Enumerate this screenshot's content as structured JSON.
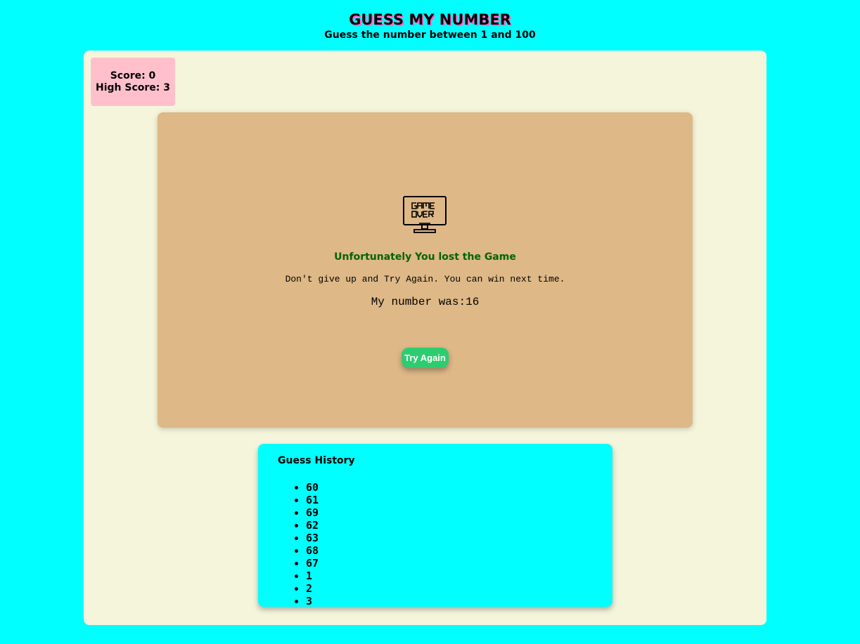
{
  "header": {
    "title": "GUESS MY NUMBER",
    "subtitle": "Guess the number between 1 and 100"
  },
  "score": {
    "score_text": "Score: 0",
    "high_score_text": "High Score: 3"
  },
  "result": {
    "icon": "game-over-monitor-icon",
    "message": "Unfortunately You lost the Game",
    "encouragement": "Don't give up and Try Again. You can win next time.",
    "number_reveal": "My number was:16",
    "try_again_label": "Try Again"
  },
  "history": {
    "title": "Guess History",
    "guesses": [
      "60",
      "61",
      "69",
      "62",
      "63",
      "68",
      "67",
      "1",
      "2",
      "3"
    ]
  },
  "colors": {
    "page_background": "#00ffff",
    "game_area": "#f5f5dc",
    "score_box": "#ffc0cb",
    "card": "#deb887",
    "lost_message": "#006400",
    "button": "#2ecc71",
    "history_panel": "#00ffff"
  }
}
